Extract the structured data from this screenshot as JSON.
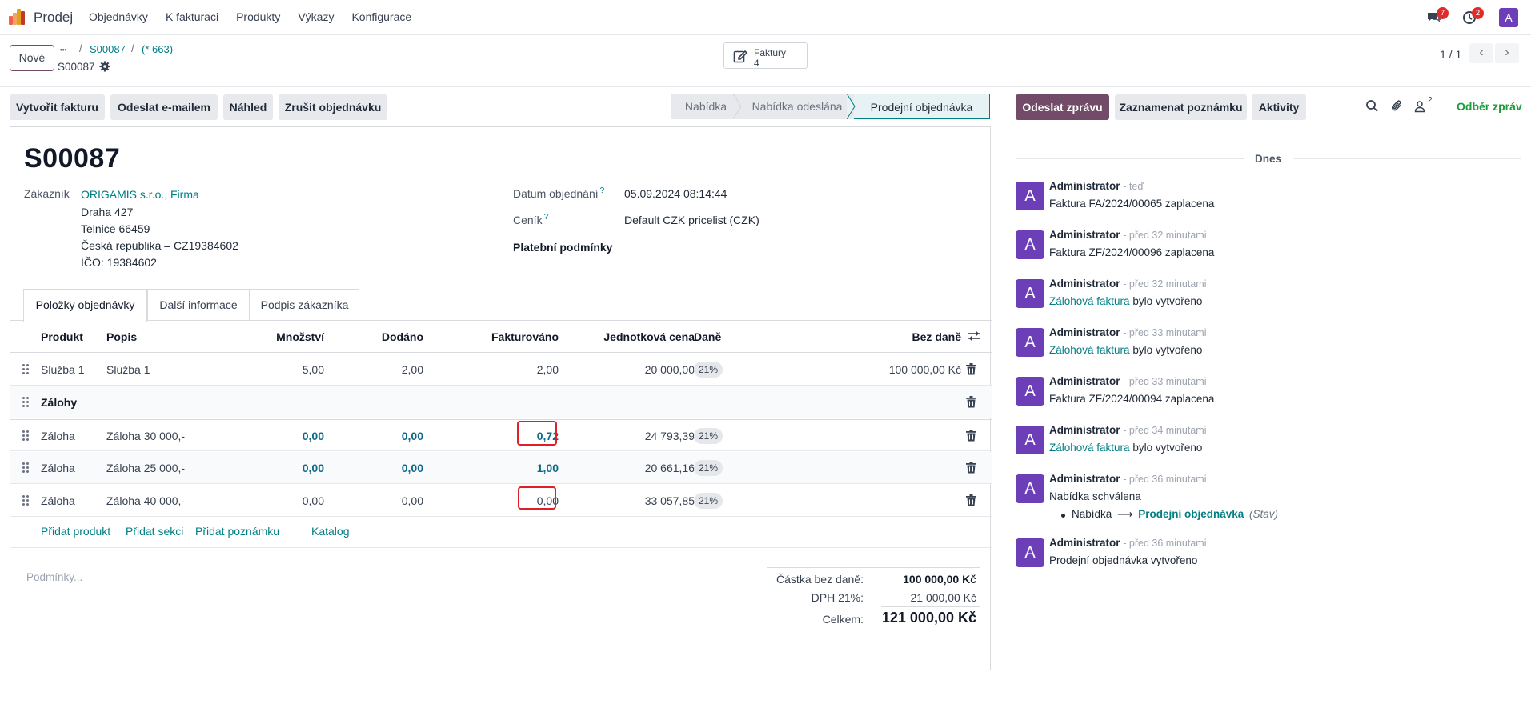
{
  "navbar": {
    "app_name": "Prodej",
    "menu": [
      "Objednávky",
      "K fakturaci",
      "Produkty",
      "Výkazy",
      "Konfigurace"
    ],
    "messages_badge": "7",
    "activities_badge": "2",
    "user_initial": "A"
  },
  "control_panel": {
    "new_label": "Nové",
    "breadcrumb_dots": "•••",
    "breadcrumb": [
      "S00087",
      "(* 663)"
    ],
    "current_record": "S00087",
    "smart_button": {
      "label": "Faktury",
      "count": "4"
    },
    "pager": "1 / 1"
  },
  "actions": [
    "Vytvořit fakturu",
    "Odeslat e-mailem",
    "Náhled",
    "Zrušit objednávku"
  ],
  "statusbar": {
    "stages": [
      "Nabídka",
      "Nabídka odeslána",
      "Prodejní objednávka"
    ],
    "active": "Prodejní objednávka"
  },
  "form": {
    "order_name": "S00087",
    "customer_label": "Zákazník",
    "customer_name": "ORIGAMIS s.r.o., Firma",
    "customer_address": [
      "Draha 427",
      "Telnice 66459",
      "Česká republika – CZ19384602",
      "IČO: 19384602"
    ],
    "date_label": "Datum objednání",
    "date_value": "05.09.2024 08:14:44",
    "pricelist_label": "Ceník",
    "pricelist_value": "Default CZK pricelist (CZK)",
    "payment_terms_label": "Platební podmínky",
    "help_mark": "?"
  },
  "tabs": [
    "Položky objednávky",
    "Další informace",
    "Podpis zákazníka"
  ],
  "table": {
    "headers": {
      "product": "Produkt",
      "description": "Popis",
      "qty": "Množství",
      "delivered": "Dodáno",
      "invoiced": "Fakturováno",
      "unit_price": "Jednotková cena",
      "taxes": "Daně",
      "subtotal": "Bez daně"
    },
    "rows": [
      {
        "product": "Služba 1",
        "description": "Služba 1",
        "qty": "5,00",
        "delivered": "2,00",
        "invoiced": "2,00",
        "unit_price": "20 000,00",
        "tax": "21%",
        "subtotal": "100 000,00 Kč"
      },
      {
        "section": "Zálohy"
      },
      {
        "product": "Záloha",
        "description": "Záloha 30 000,-",
        "qty": "0,00",
        "delivered": "0,00",
        "invoiced": "0,72",
        "unit_price": "24 793,39",
        "tax": "21%",
        "subtotal": ""
      },
      {
        "product": "Záloha",
        "description": "Záloha 25 000,-",
        "qty": "0,00",
        "delivered": "0,00",
        "invoiced": "1,00",
        "unit_price": "20 661,16",
        "tax": "21%",
        "subtotal": ""
      },
      {
        "product": "Záloha",
        "description": "Záloha 40 000,-",
        "qty": "0,00",
        "delivered": "0,00",
        "invoiced": "0,00",
        "unit_price": "33 057,85",
        "tax": "21%",
        "subtotal": ""
      }
    ],
    "add_links": [
      "Přidat produkt",
      "Přidat sekci",
      "Přidat poznámku",
      "Katalog"
    ],
    "terms_placeholder": "Podmínky..."
  },
  "totals": {
    "untaxed_label": "Částka bez daně:",
    "untaxed_value": "100 000,00 Kč",
    "vat_label": "DPH 21%:",
    "vat_value": "21 000,00 Kč",
    "total_label": "Celkem:",
    "total_value": "121 000,00 Kč"
  },
  "chatter": {
    "send_message": "Odeslat zprávu",
    "log_note": "Zaznamenat poznámku",
    "activities": "Aktivity",
    "followers_count": "2",
    "follow": "Odběr zpráv",
    "day": "Dnes",
    "messages": [
      {
        "author": "Administrator",
        "time": "- teď",
        "body_pre": "Faktura FA/2024/00065 zaplacena",
        "link": "",
        "body_post": ""
      },
      {
        "author": "Administrator",
        "time": "- před 32 minutami",
        "body_pre": "Faktura ZF/2024/00096 zaplacena",
        "link": "",
        "body_post": ""
      },
      {
        "author": "Administrator",
        "time": "- před 32 minutami",
        "body_pre": "",
        "link": "Zálohová faktura",
        "body_post": " bylo vytvořeno"
      },
      {
        "author": "Administrator",
        "time": "- před 33 minutami",
        "body_pre": "",
        "link": "Zálohová faktura",
        "body_post": " bylo vytvořeno"
      },
      {
        "author": "Administrator",
        "time": "- před 33 minutami",
        "body_pre": "Faktura ZF/2024/00094 zaplacena",
        "link": "",
        "body_post": ""
      },
      {
        "author": "Administrator",
        "time": "- před 34 minutami",
        "body_pre": "",
        "link": "Zálohová faktura",
        "body_post": " bylo vytvořeno"
      },
      {
        "author": "Administrator",
        "time": "- před 36 minutami",
        "body_pre": "Nabídka schválena",
        "link": "",
        "body_post": ""
      },
      {
        "author": "Administrator",
        "time": "- před 36 minutami",
        "body_pre": "Prodejní objednávka vytvořeno",
        "link": "",
        "body_post": ""
      }
    ],
    "tracking": {
      "old": "Nabídka",
      "arrow": "⟶",
      "new": "Prodejní objednávka",
      "field": "(Stav)"
    }
  },
  "colors": {
    "brand": "#714b67",
    "link": "#017e84",
    "avatar": "#6c3fb8",
    "highlight": "#e11d27",
    "follow": "#1a9d3a"
  }
}
